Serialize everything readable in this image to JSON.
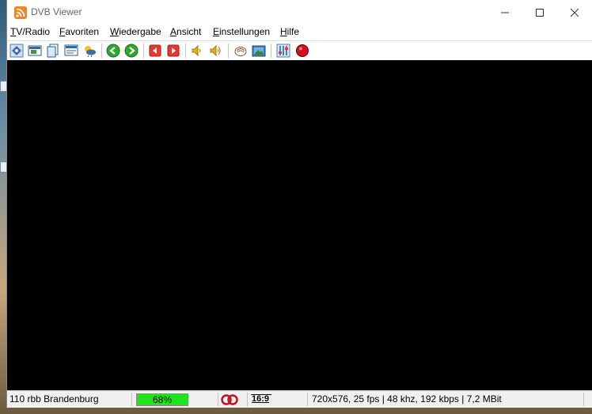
{
  "window": {
    "title": "DVB Viewer",
    "minimize_icon": "minimize-icon",
    "maximize_icon": "maximize-icon",
    "close_icon": "close-icon"
  },
  "menu": {
    "items": [
      {
        "label": "TV/Radio",
        "accel": "T"
      },
      {
        "label": "Favoriten",
        "accel": "F"
      },
      {
        "label": "Wiedergabe",
        "accel": "W"
      },
      {
        "label": "Ansicht",
        "accel": "A"
      },
      {
        "label": "Einstellungen",
        "accel": "E"
      },
      {
        "label": "Hilfe",
        "accel": "H"
      }
    ]
  },
  "toolbar": {
    "buttons": [
      "channel-list-icon",
      "picture-in-picture-icon",
      "windows-icon",
      "teletext-icon",
      "weather-icon",
      "back-icon",
      "forward-icon",
      "previous-channel-icon",
      "next-channel-icon",
      "volume-down-icon",
      "volume-up-icon",
      "epg-icon",
      "snapshot-icon",
      "settings-icon",
      "record-icon"
    ]
  },
  "status": {
    "channel": "110 rbb Brandenburg",
    "signal_percent": 68,
    "signal_label": "68%",
    "aspect": "16:9",
    "stream_info": "720x576, 25 fps | 48 khz, 192 kbps | 7,2 MBit"
  },
  "colors": {
    "signal_bar": "#21e41f",
    "record": "#d0101a",
    "app_icon": "#f3831f"
  }
}
